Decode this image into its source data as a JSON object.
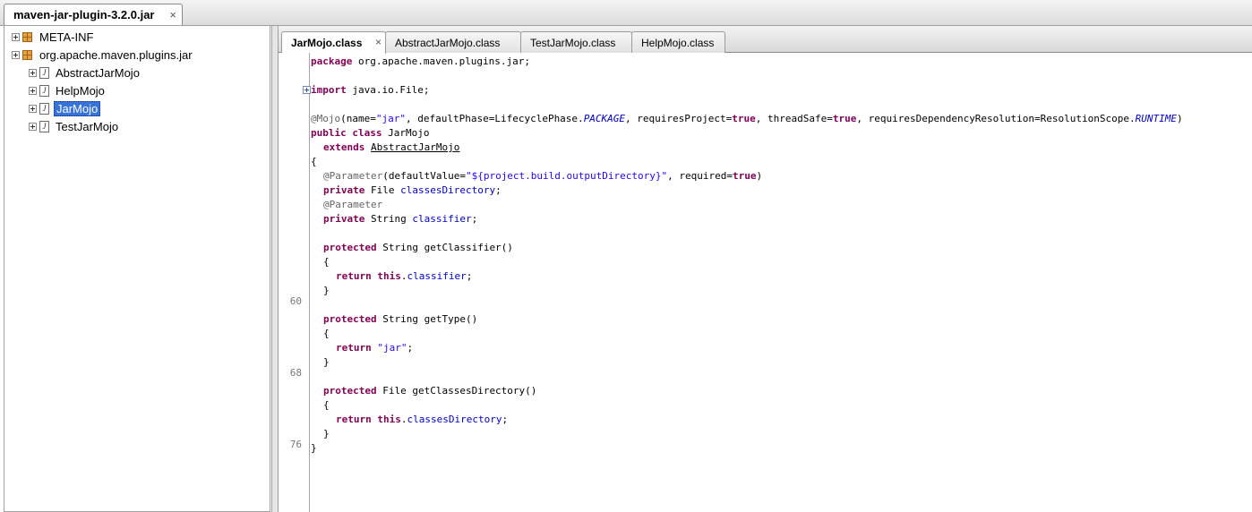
{
  "window": {
    "file_tab": "maven-jar-plugin-3.2.0.jar",
    "close_glyph": "×"
  },
  "tree": {
    "items": [
      {
        "label": "META-INF",
        "type": "package"
      },
      {
        "label": "org.apache.maven.plugins.jar",
        "type": "package"
      },
      {
        "label": "AbstractJarMojo",
        "type": "class"
      },
      {
        "label": "HelpMojo",
        "type": "class"
      },
      {
        "label": "JarMojo",
        "type": "class",
        "selected": true
      },
      {
        "label": "TestJarMojo",
        "type": "class"
      }
    ]
  },
  "editor": {
    "tabs": [
      {
        "label": "JarMojo.class",
        "active": true
      },
      {
        "label": "AbstractJarMojo.class"
      },
      {
        "label": "TestJarMojo.class"
      },
      {
        "label": "HelpMojo.class"
      }
    ],
    "line_numbers": [
      "60",
      "68",
      "76"
    ],
    "code": {
      "l1_kw": "package",
      "l1_rest": " org.apache.maven.plugins.jar;",
      "l2_kw": "import",
      "l2_rest": " java.io.File;",
      "l3_ann": "@Mojo",
      "l3_a": "(name=",
      "l3_s1": "\"jar\"",
      "l3_b": ", defaultPhase=LifecyclePhase.",
      "l3_i1": "PACKAGE",
      "l3_c": ", requiresProject=",
      "l3_k1": "true",
      "l3_d": ", threadSafe=",
      "l3_k2": "true",
      "l3_e": ", requiresDependencyResolution=ResolutionScope.",
      "l3_i2": "RUNTIME",
      "l3_f": ")",
      "l4_kw": "public class",
      "l4_rest": " JarMojo",
      "l5_kw": "extends",
      "l5_sp": " ",
      "l5_type": "AbstractJarMojo",
      "l6": "{",
      "l7_ann": "@Parameter",
      "l7_a": "(defaultValue=",
      "l7_s": "\"${project.build.outputDirectory}\"",
      "l7_b": ", required=",
      "l7_k": "true",
      "l7_c": ")",
      "l8_kw": "private",
      "l8_a": " File ",
      "l8_f": "classesDirectory",
      "l8_b": ";",
      "l9_ann": "@Parameter",
      "l10_kw": "private",
      "l10_a": " String ",
      "l10_f": "classifier",
      "l10_b": ";",
      "l11_kw": "protected",
      "l11_rest": " String getClassifier()",
      "l12": "{",
      "l13_kw": "return this",
      "l13_a": ".",
      "l13_f": "classifier",
      "l13_b": ";",
      "l14": "}",
      "l15_kw": "protected",
      "l15_rest": " String getType()",
      "l16": "{",
      "l17_kw": "return",
      "l17_a": " ",
      "l17_s": "\"jar\"",
      "l17_b": ";",
      "l18": "}",
      "l19_kw": "protected",
      "l19_rest": " File getClassesDirectory()",
      "l20": "{",
      "l21_kw": "return this",
      "l21_a": ".",
      "l21_f": "classesDirectory",
      "l21_b": ";",
      "l22": "}",
      "l23": "}"
    }
  }
}
